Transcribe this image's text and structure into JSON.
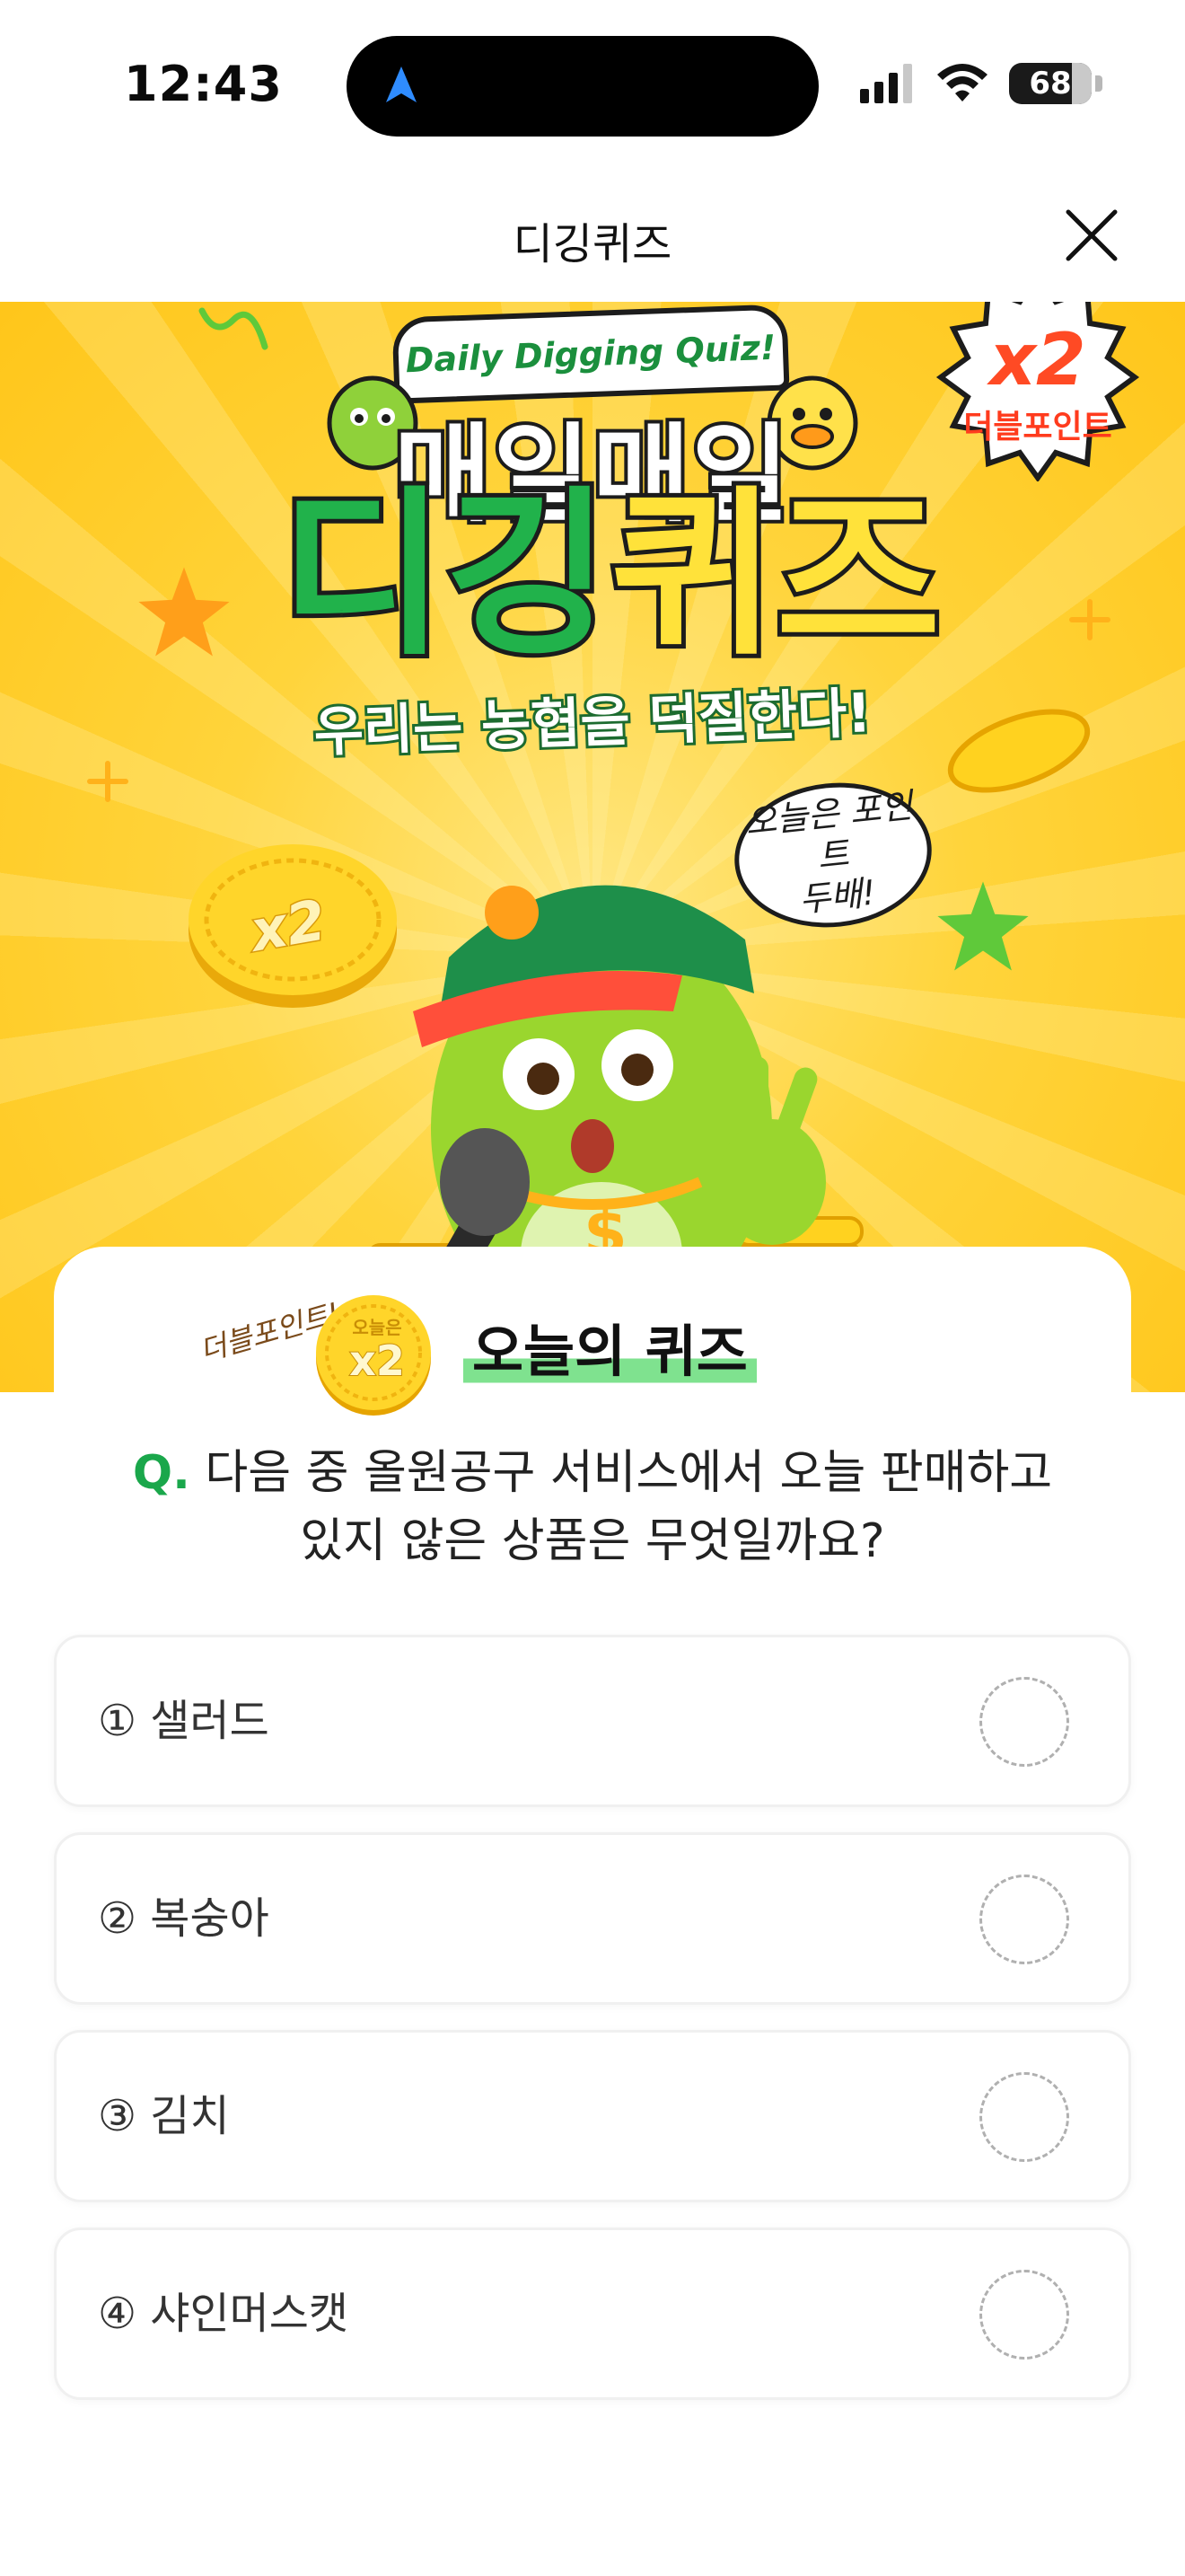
{
  "status_bar": {
    "time": "12:43",
    "battery": "68",
    "icons": [
      "location-arrow-icon",
      "signal-icon",
      "wifi-icon",
      "battery-icon"
    ]
  },
  "header": {
    "title": "디깅퀴즈",
    "close_icon": "close-icon"
  },
  "banner": {
    "ribbon": "Daily Digging Quiz!",
    "title_line1": "매일매일",
    "title_line2_green": "디깅",
    "title_line2_yellow": "퀴즈",
    "slogan": "우리는 농협을 덕질한다!",
    "badge_x2": "x2",
    "badge_label": "더블포인트",
    "speech_bubble": "오늘은 포인트\n두배!",
    "coin_label": "x2"
  },
  "quiz": {
    "handnote": "더블포인트!",
    "coin_top": "오늘은",
    "coin_x2": "x2",
    "section_title": "오늘의 퀴즈",
    "question_marker": "Q.",
    "question_line1": "다음 중 올원공구 서비스에서 오늘 판매하고",
    "question_line2": "있지 않은 상품은 무엇일까요?",
    "options": [
      {
        "label": "① 샐러드"
      },
      {
        "label": "② 복숭아"
      },
      {
        "label": "③ 김치"
      },
      {
        "label": "④ 샤인머스캣"
      }
    ]
  },
  "colors": {
    "accent_green": "#1aa74b",
    "banner_yellow": "#ffd43b",
    "badge_red": "#ff4a24"
  }
}
